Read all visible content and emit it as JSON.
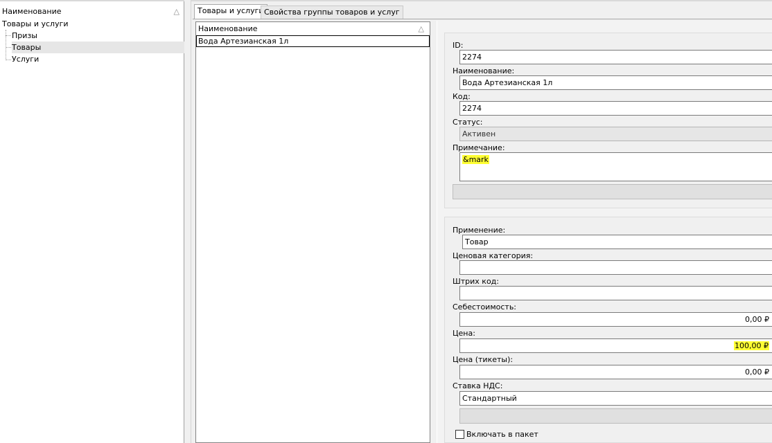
{
  "tree": {
    "header": "Наименование",
    "sort_icon": "triangle-sort-icon",
    "root": "Товары и услуги",
    "items": [
      {
        "label": "Призы"
      },
      {
        "label": "Товары",
        "selected": true
      },
      {
        "label": "Услуги"
      }
    ]
  },
  "tabs": [
    {
      "label": "Товары и услуги",
      "active": true
    },
    {
      "label": "Свойства группы товаров и услуг",
      "active": false
    }
  ],
  "list": {
    "header": "Наименование",
    "rows": [
      "Вода Артезианская 1л"
    ]
  },
  "props": {
    "id_label": "ID:",
    "id_value": "2274",
    "name_label": "Наименование:",
    "name_value": "Вода Артезианская 1л",
    "code_label": "Код:",
    "code_value": "2274",
    "status_label": "Статус:",
    "status_value": "Активен",
    "note_label": "Примечание:",
    "note_value": "&mark",
    "usage_label": "Применение:",
    "usage_value": "Товар",
    "price_cat_label": "Ценовая категория:",
    "price_cat_value": "",
    "barcode_label": "Штрих код:",
    "barcode_value": "",
    "cost_label": "Себестоимость:",
    "cost_value": "0,00 ₽",
    "price_label": "Цена:",
    "price_value": "100,00 ₽",
    "price_tickets_label": "Цена (тикеты):",
    "price_tickets_value": "0,00 ₽",
    "vat_label": "Ставка НДС:",
    "vat_value": "Стандартный",
    "package_label": "Включать в пакет",
    "package_checked": false
  },
  "highlight_color": "#ffff33"
}
